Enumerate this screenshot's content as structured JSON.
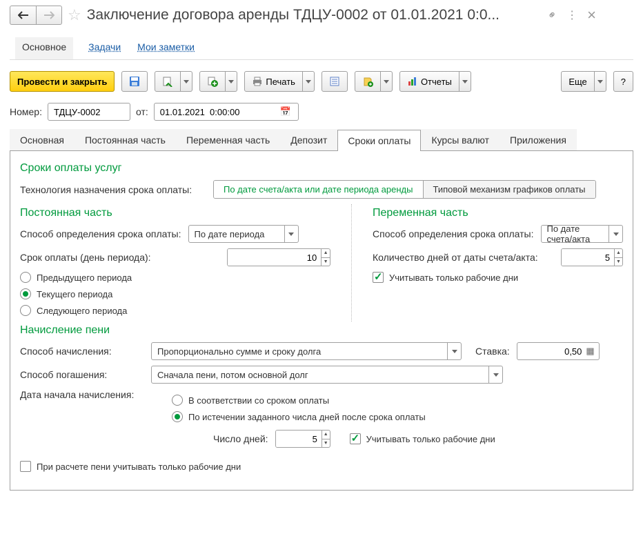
{
  "title": "Заключение договора аренды ТДЦУ-0002 от 01.01.2021 0:0...",
  "form_tabs": {
    "main": "Основное",
    "tasks": "Задачи",
    "notes": "Мои заметки"
  },
  "toolbar": {
    "post_and_close": "Провести и закрыть",
    "print": "Печать",
    "reports": "Отчеты",
    "more": "Еще",
    "help": "?"
  },
  "header": {
    "number_label": "Номер:",
    "number": "ТДЦУ-0002",
    "from_label": "от:",
    "date": "01.01.2021  0:00:00"
  },
  "page_tabs": [
    "Основная",
    "Постоянная часть",
    "Переменная часть",
    "Депозит",
    "Сроки оплаты",
    "Курсы валют",
    "Приложения"
  ],
  "active_tab": "Сроки оплаты",
  "payment": {
    "section_title": "Сроки оплаты услуг",
    "tech_label": "Технология назначения срока оплаты:",
    "toggle_a": "По дате счета/акта или дате периода аренды",
    "toggle_b": "Типовой механизм графиков оплаты",
    "fixed": {
      "title": "Постоянная часть",
      "method_label": "Способ определения срока оплаты:",
      "method_value": "По дате периода",
      "day_label": "Срок оплаты (день периода):",
      "day_value": "10",
      "radios": [
        "Предыдущего периода",
        "Текущего периода",
        "Следующего периода"
      ]
    },
    "variable": {
      "title": "Переменная часть",
      "method_label": "Способ определения срока оплаты:",
      "method_value": "По дате счета/акта",
      "days_label": "Количество дней от даты счета/акта:",
      "days_value": "5",
      "workdays": "Учитывать только рабочие дни"
    }
  },
  "penalty": {
    "title": "Начисление пени",
    "method_label": "Способ начисления:",
    "method_value": "Пропорционально сумме и сроку долга",
    "rate_label": "Ставка:",
    "rate_value": "0,50",
    "repay_label": "Способ погашения:",
    "repay_value": "Сначала пени, потом основной долг",
    "startdate_label": "Дата начала начисления:",
    "radio_a": "В соответствии со сроком оплаты",
    "radio_b": "По истечении заданного числа дней после срока оплаты",
    "daycount_label": "Число дней:",
    "daycount_value": "5",
    "workdays": "Учитывать только рабочие дни",
    "calc_workdays": "При расчете пени учитывать только рабочие дни"
  }
}
